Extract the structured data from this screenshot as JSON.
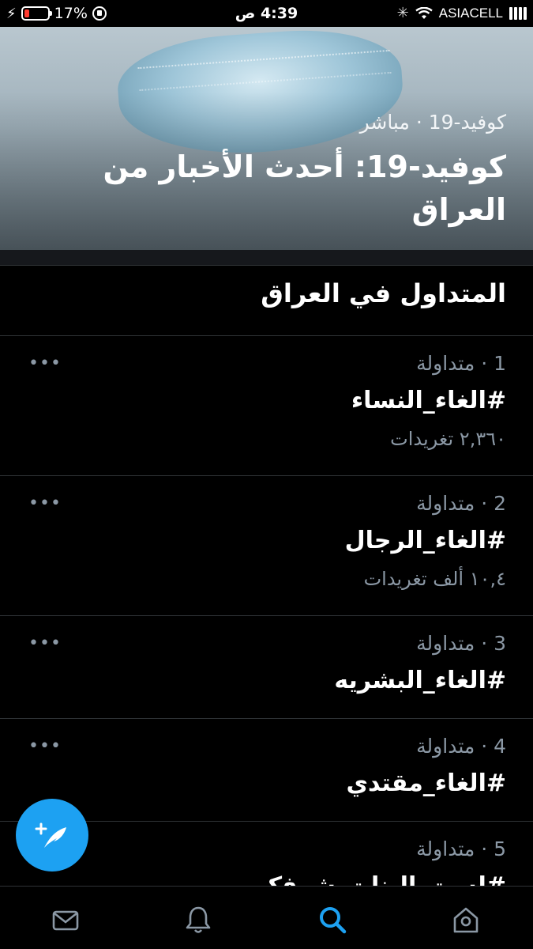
{
  "status_bar": {
    "battery": "17%",
    "time": "4:39 ص",
    "carrier": "ASIACELL"
  },
  "hero": {
    "subtitle": "كوفيد-19 · مباشر",
    "title": "كوفيد-19: أحدث الأخبار من العراق"
  },
  "section": {
    "title": "المتداول في العراق"
  },
  "trends": [
    {
      "meta": "1 · متداولة",
      "tag": "#الغاء_النساء",
      "count": "٢,٣٦٠ تغريدات"
    },
    {
      "meta": "2 · متداولة",
      "tag": "#الغاء_الرجال",
      "count": "١٠,٤ ألف تغريدات"
    },
    {
      "meta": "3 · متداولة",
      "tag": "#الغاء_البشريه",
      "count": ""
    },
    {
      "meta": "4 · متداولة",
      "tag": "#الغاء_مقتدي",
      "count": ""
    },
    {
      "meta": "5 · متداولة",
      "tag": "#لست_البنات_شرفكم",
      "count": ""
    }
  ],
  "more_label": "•••",
  "colors": {
    "accent": "#1da1f2",
    "secondary_text": "#8b98a5",
    "divider": "#2f3336"
  },
  "tabs": [
    "messages-icon",
    "notifications-icon",
    "search-icon",
    "home-icon"
  ]
}
